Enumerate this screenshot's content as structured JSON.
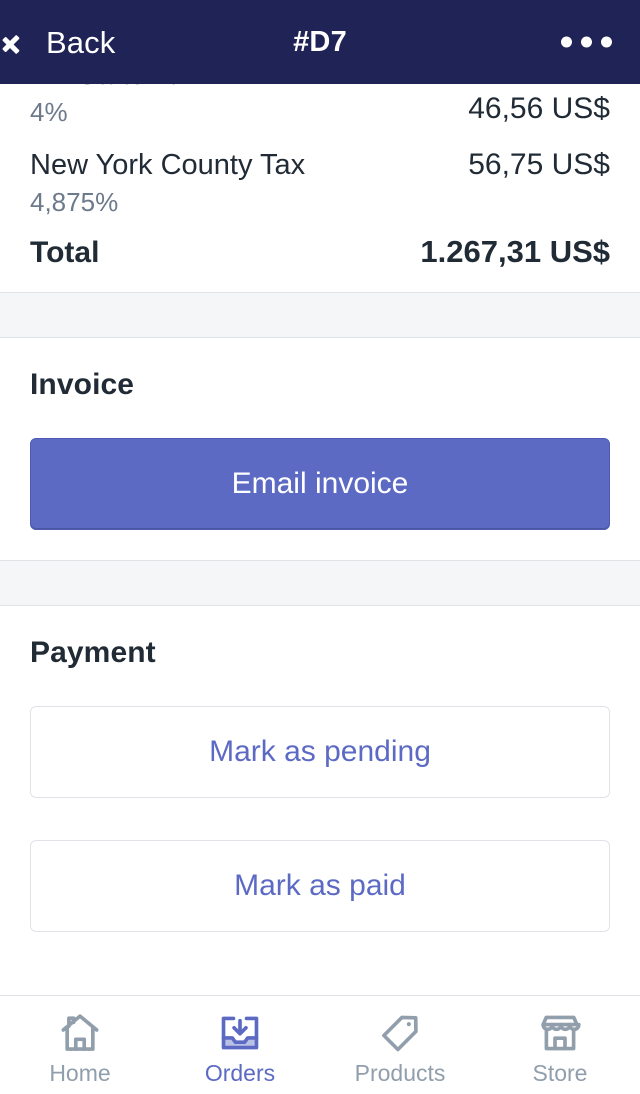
{
  "header": {
    "back_label": "Back",
    "title": "#D7",
    "more_icon": "ellipsis-icon",
    "back_icon": "chevron-left-icon",
    "background_color": "#202356"
  },
  "summary": {
    "rows": [
      {
        "name": "NY State Tax",
        "sub": "4%",
        "amount": "46,56 US$"
      },
      {
        "name": "New York County Tax",
        "sub": "4,875%",
        "amount": "56,75 US$"
      }
    ],
    "total": {
      "label": "Total",
      "amount": "1.267,31 US$"
    }
  },
  "invoice": {
    "title": "Invoice",
    "email_button": "Email invoice"
  },
  "payment": {
    "title": "Payment",
    "mark_pending_button": "Mark as pending",
    "mark_paid_button": "Mark as paid"
  },
  "tabbar": {
    "items": [
      {
        "label": "Home",
        "icon": "home-icon",
        "active": false
      },
      {
        "label": "Orders",
        "icon": "inbox-arrow-down-icon",
        "active": true
      },
      {
        "label": "Products",
        "icon": "tag-icon",
        "active": false
      },
      {
        "label": "Store",
        "icon": "storefront-icon",
        "active": false
      }
    ]
  },
  "colors": {
    "accent": "#5c6ac4",
    "header": "#202356",
    "text": "#212b36",
    "muted": "#6d7a8c",
    "divider": "#dfe3e8",
    "band": "#f4f6f8"
  }
}
